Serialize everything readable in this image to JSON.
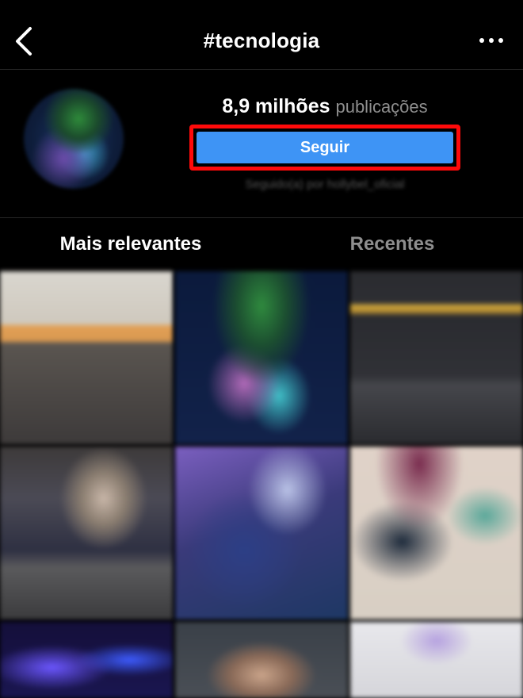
{
  "header": {
    "title": "#tecnologia",
    "back_icon": "chevron-left-icon",
    "more_icon": "more-horizontal-icon"
  },
  "profile": {
    "posts_count": "8,9 milhões",
    "posts_label": "publicações",
    "follow_label": "Seguir",
    "followed_by": "Seguido(a) por hollybel_oficial"
  },
  "tabs": {
    "top_label": "Mais relevantes",
    "recent_label": "Recentes"
  },
  "colors": {
    "background": "#000000",
    "follow_button": "#3e94f5",
    "highlight": "#ff0a0a",
    "muted_text": "#8e8e8e"
  }
}
